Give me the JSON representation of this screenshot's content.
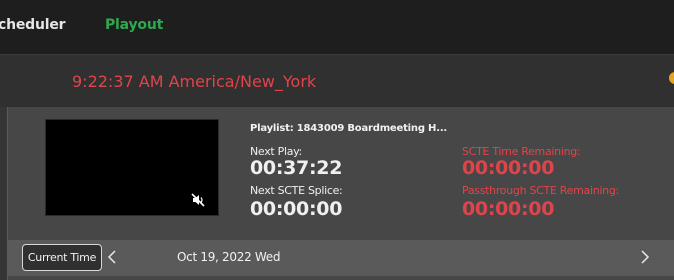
{
  "nav": {
    "items": [
      {
        "label": "cheduler"
      },
      {
        "label": "Playout"
      }
    ]
  },
  "clock": {
    "text": "9:22:37 AM America/New_York"
  },
  "player": {
    "playlist_title": "Playlist: 1843009 Boardmeeting H...",
    "next_play_label": "Next Play:",
    "next_play_value": "00:37:22",
    "next_scte_splice_label": "Next SCTE Splice:",
    "next_scte_splice_value": "00:00:00",
    "scte_time_remaining_label": "SCTE Time Remaining:",
    "scte_time_remaining_value": "00:00:00",
    "passthrough_scte_remaining_label": "Passthrough SCTE Remaining:",
    "passthrough_scte_remaining_value": "00:00:00",
    "mute_icon": "speaker-muted-icon"
  },
  "datebar": {
    "current_time_label": "Current Time",
    "date_text": "Oct 19, 2022 Wed",
    "prev_icon": "chevron-left-icon",
    "next_icon": "chevron-right-icon"
  },
  "colors": {
    "accent_red": "#e0444b",
    "accent_green": "#2fa84f",
    "status_dot": "#e3a521"
  }
}
